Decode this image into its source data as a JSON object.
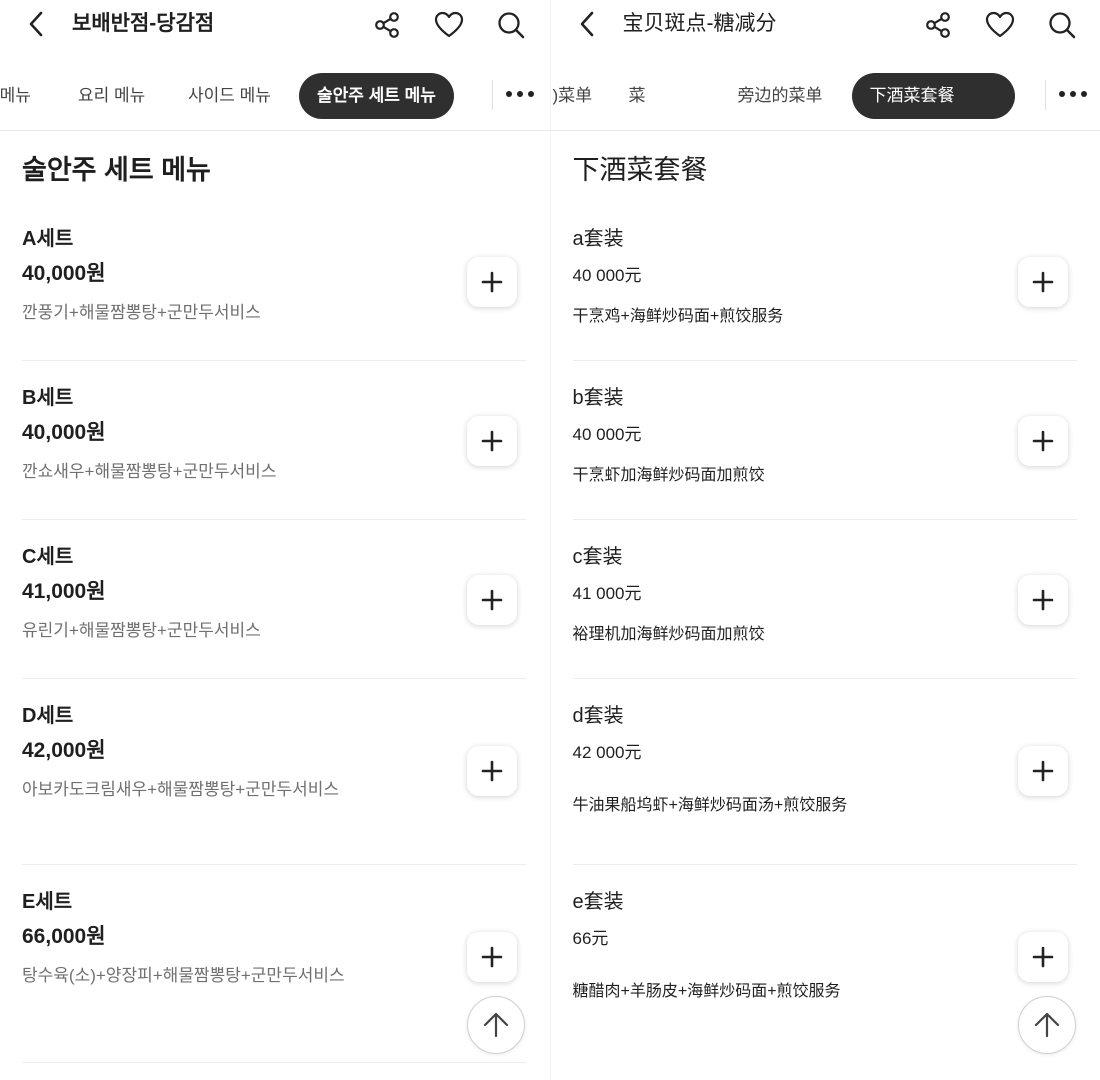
{
  "colors": {
    "active_tab_bg": "#2f2f2f",
    "text": "#1f1f1f",
    "muted": "#707070"
  },
  "icons": [
    "back-arrow-icon",
    "share-icon",
    "heart-icon",
    "search-icon",
    "more-dots-icon",
    "plus-icon",
    "arrow-up-icon"
  ],
  "left": {
    "title": "보배반점-당감점",
    "tabs": [
      ")메뉴",
      "요리 메뉴",
      "사이드 메뉴",
      "술안주 세트 메뉴"
    ],
    "section_title": "술안주 세트 메뉴",
    "items": [
      {
        "name": "A세트",
        "price": "40,000원",
        "desc": "깐풍기+해물짬뽕탕+군만두서비스"
      },
      {
        "name": "B세트",
        "price": "40,000원",
        "desc": "깐쇼새우+해물짬뽕탕+군만두서비스"
      },
      {
        "name": "C세트",
        "price": "41,000원",
        "desc": "유린기+해물짬뽕탕+군만두서비스"
      },
      {
        "name": "D세트",
        "price": "42,000원",
        "desc": "아보카도크림새우+해물짬뽕탕+군만두서비스"
      },
      {
        "name": "E세트",
        "price": "66,000원",
        "desc": "탕수육(소)+양장피+해물짬뽕탕+군만두서비스"
      }
    ]
  },
  "right": {
    "title": "宝贝斑点-糖减分",
    "tabs": [
      ")菜单",
      "菜",
      "旁边的菜单",
      "下酒菜套餐"
    ],
    "section_title": "下酒菜套餐",
    "items": [
      {
        "name": "a套装",
        "price": "40 000元",
        "desc": "干烹鸡+海鲜炒码面+煎饺服务"
      },
      {
        "name": "b套装",
        "price": "40 000元",
        "desc": "干烹虾加海鲜炒码面加煎饺"
      },
      {
        "name": "c套装",
        "price": "41 000元",
        "desc": "裕理机加海鲜炒码面加煎饺"
      },
      {
        "name": "d套装",
        "price": "42 000元",
        "desc": "牛油果船坞虾+海鲜炒码面汤+煎饺服务"
      },
      {
        "name": "e套装",
        "price": "66元",
        "desc": "糖醋肉+羊肠皮+海鲜炒码面+煎饺服务"
      }
    ]
  }
}
